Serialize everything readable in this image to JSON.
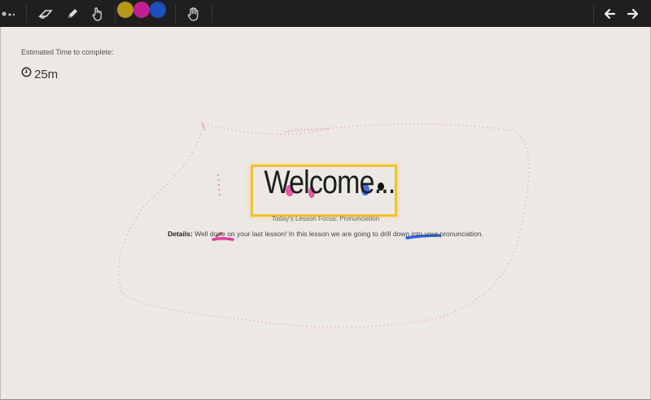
{
  "toolbar": {
    "tools": [
      {
        "name": "more",
        "icon": "more-dots-icon"
      },
      {
        "name": "eraser",
        "icon": "eraser-icon"
      },
      {
        "name": "pencil",
        "icon": "pencil-icon"
      },
      {
        "name": "pointer",
        "icon": "pointer-hand-icon"
      }
    ],
    "colors": [
      "#b8961a",
      "#c0208f",
      "#1f4fbf"
    ],
    "pan_icon": "pan-hand-icon",
    "nav": [
      "arrow-left-icon",
      "arrow-right-icon"
    ]
  },
  "lesson": {
    "estimated_label": "Estimated Time to complete:",
    "clock_icon": "clock-icon",
    "time": "25m",
    "welcome": "Welcome...",
    "focus": "Today's Lesson Focus: Pronunciation",
    "details_label": "Details:",
    "details_text": " Well done on your last lesson! In this lesson we are going to drill down into your pronunciation."
  },
  "ink_colors": {
    "pink": "#e0409a",
    "blue": "#2a62e8",
    "black": "#111111",
    "highlight": "#f4c030"
  }
}
